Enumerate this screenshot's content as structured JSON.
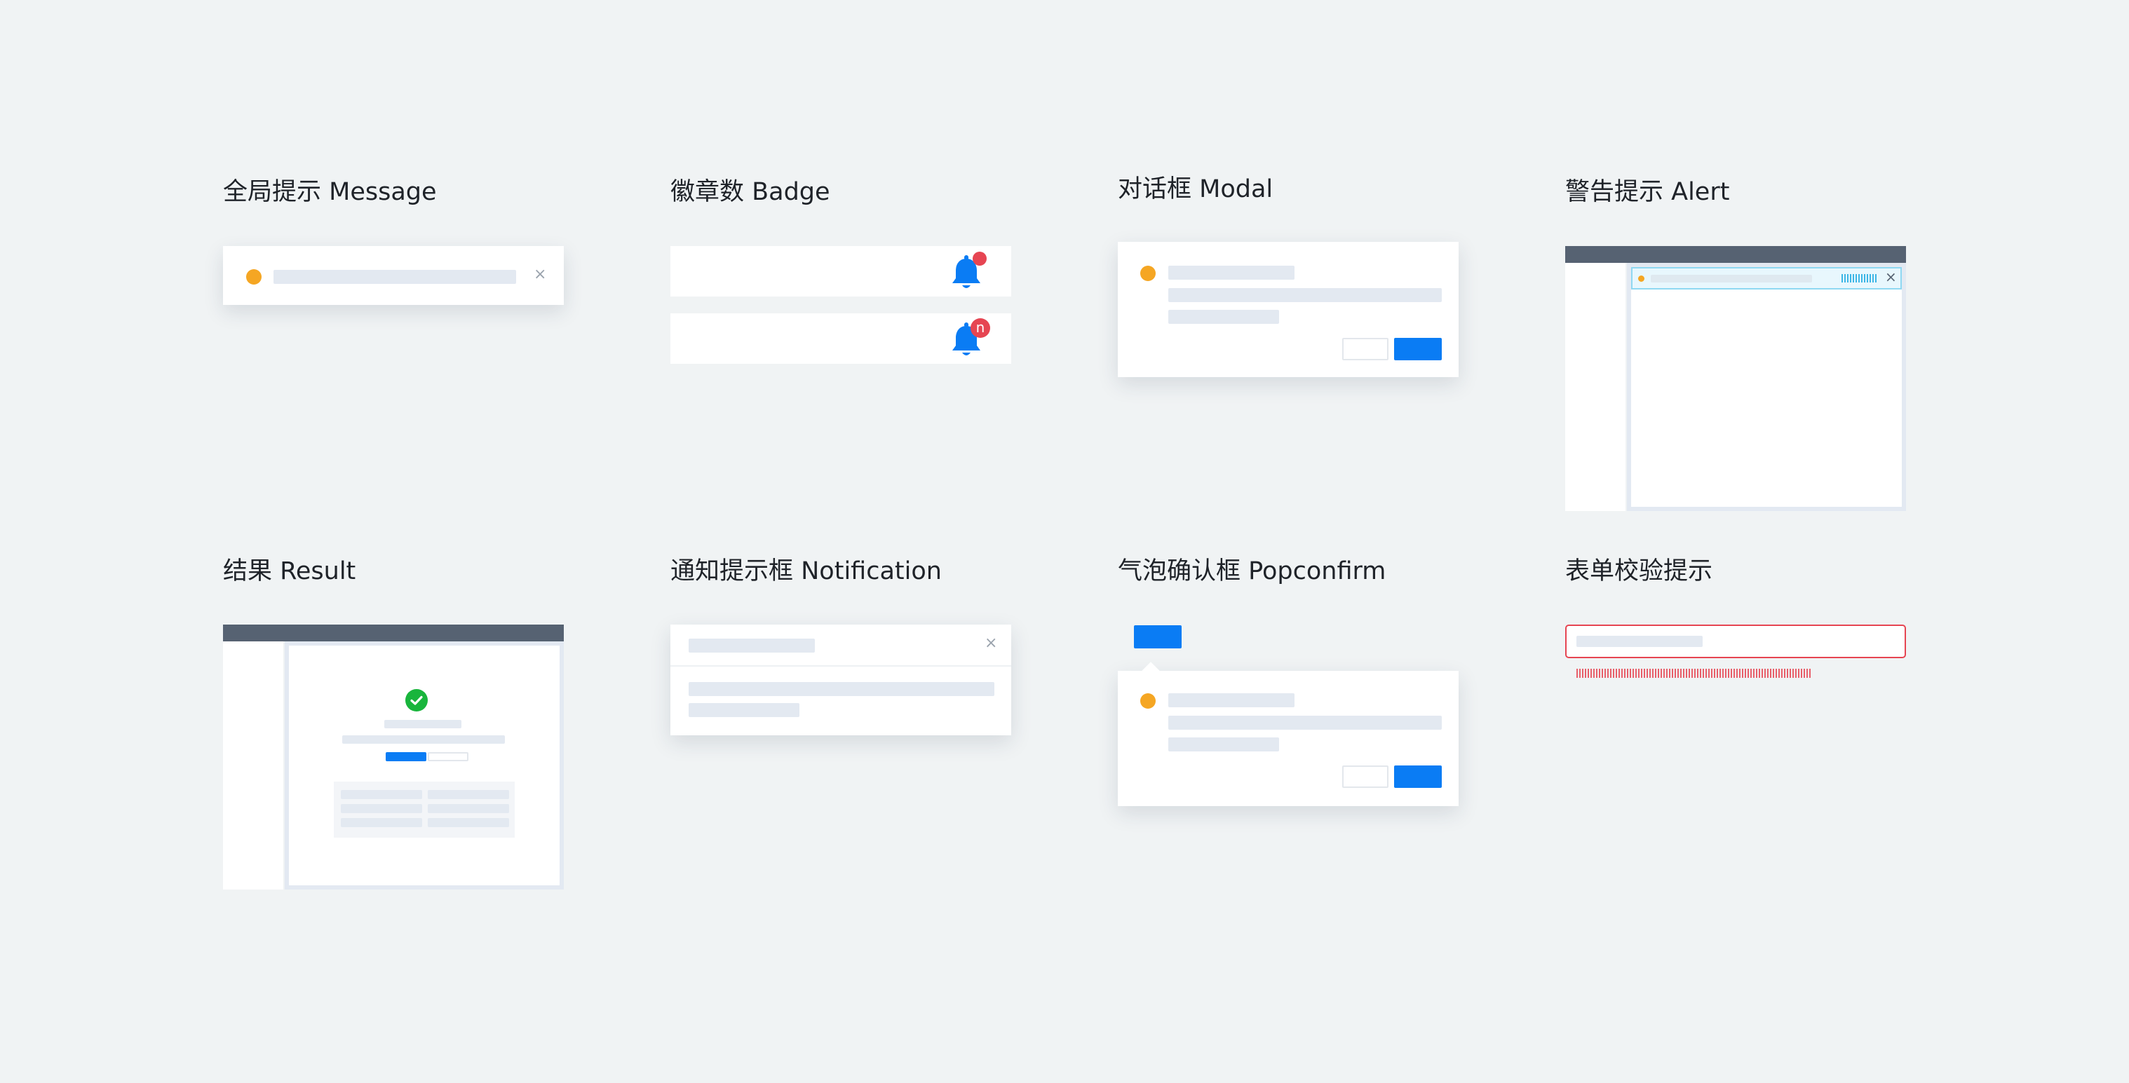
{
  "sections": {
    "message": {
      "title": "全局提示 Message",
      "close_glyph": "×"
    },
    "badge": {
      "title": "徽章数 Badge",
      "count_badge": "n"
    },
    "modal": {
      "title": "对话框 Modal"
    },
    "alert": {
      "title": "警告提示 Alert",
      "close_glyph": "×"
    },
    "result": {
      "title": "结果 Result"
    },
    "notification": {
      "title": "通知提示框 Notification",
      "close_glyph": "×"
    },
    "popconfirm": {
      "title": "气泡确认框 Popconfirm"
    },
    "form_validation": {
      "title": "表单校验提示"
    }
  },
  "colors": {
    "page_bg": "#f0f3f4",
    "primary": "#0a7cf4",
    "warning": "#f5a623",
    "error": "#e64552",
    "success": "#19b53c",
    "header": "#566272",
    "placeholder": "#e3e9f1",
    "alert_info_border": "#8fd8f2"
  },
  "icons": {
    "warning": "warning-dot-icon",
    "close": "close-icon",
    "bell": "bell-icon",
    "success": "check-circle-icon"
  }
}
